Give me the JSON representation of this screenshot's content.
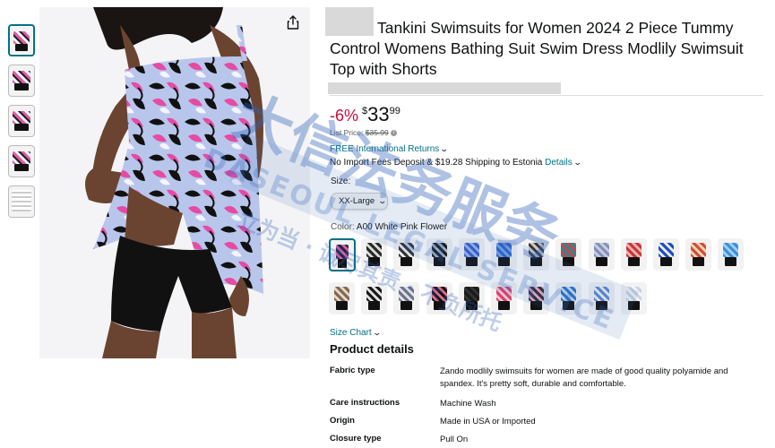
{
  "product": {
    "title": "Tankini Swimsuits for Women 2024 2 Piece Tummy Control Womens Bathing Suit Swim Dress Modlily Swimsuit Top with Shorts",
    "discount": "-6%",
    "currency": "$",
    "price_whole": "33",
    "price_fraction": "99",
    "list_price_label": "List Price:",
    "list_price_value": "$35.99"
  },
  "shipping": {
    "intl_returns": "FREE International Returns",
    "fees_text": "No Import Fees Deposit & $19.28 Shipping to Estonia",
    "details_link": "Details"
  },
  "size": {
    "label": "Size:",
    "selected": "XX-Large"
  },
  "color": {
    "label": "Color:",
    "selected": "A00 White Pink Flower",
    "swatch_colors": [
      [
        "#1d2a4a",
        "#e35aa5"
      ],
      [
        "#2a2a2a",
        "#dcdcdc"
      ],
      [
        "#333",
        "#f0f0f0"
      ],
      [
        "#111",
        "#bbb"
      ],
      [
        "#3a5fc8",
        "#9ab6ef"
      ],
      [
        "#2c63c9",
        "#7aa2e8"
      ],
      [
        "#c8c8c8",
        "#333"
      ],
      [
        "#2b8a7f",
        "#d23c5b"
      ],
      [
        "#8a8fb2",
        "#c0d0ea"
      ],
      [
        "#c23a3a",
        "#f0b0b0"
      ],
      [
        "#1e4fbd",
        "#e9eef9"
      ],
      [
        "#d34b3c",
        "#f2d7b0"
      ],
      [
        "#3f8ed8",
        "#9fd0f2"
      ],
      [
        "#7a6a5a",
        "#ecd7c0"
      ],
      [
        "#1a1a1a",
        "#e2e2e2"
      ],
      [
        "#6f7386",
        "#dfe1ec"
      ],
      [
        "#111",
        "#e36a86"
      ],
      [
        "#1a1a1a",
        "#333"
      ],
      [
        "#d8436f",
        "#f7c6d4"
      ],
      [
        "#2d2d2d",
        "#f2a6c6"
      ],
      [
        "#2874c4",
        "#c9ddf4"
      ],
      [
        "#5c88d1",
        "#f0f0f0"
      ],
      [
        "#c9d2e3",
        "#f4f6fa"
      ]
    ]
  },
  "links": {
    "size_chart": "Size Chart"
  },
  "product_details": {
    "heading": "Product details",
    "rows": [
      {
        "key": "Fabric type",
        "value": "Zando modlily swimsuits for women are made of good quality polyamide and spandex. It's pretty soft, durable and comfortable."
      },
      {
        "key": "Care instructions",
        "value": "Machine Wash"
      },
      {
        "key": "Origin",
        "value": "Made in USA or Imported"
      },
      {
        "key": "Closure type",
        "value": "Pull On"
      }
    ]
  },
  "watermark": {
    "line1": "大信法务服务",
    "line2": "DASEOUL LEGAL SERVICE",
    "line3": "立为当 · 诚尽其责 · 不负所托"
  },
  "icons": {
    "share": "share-icon",
    "info": "info-icon",
    "chevron": "chevron-down-icon"
  }
}
